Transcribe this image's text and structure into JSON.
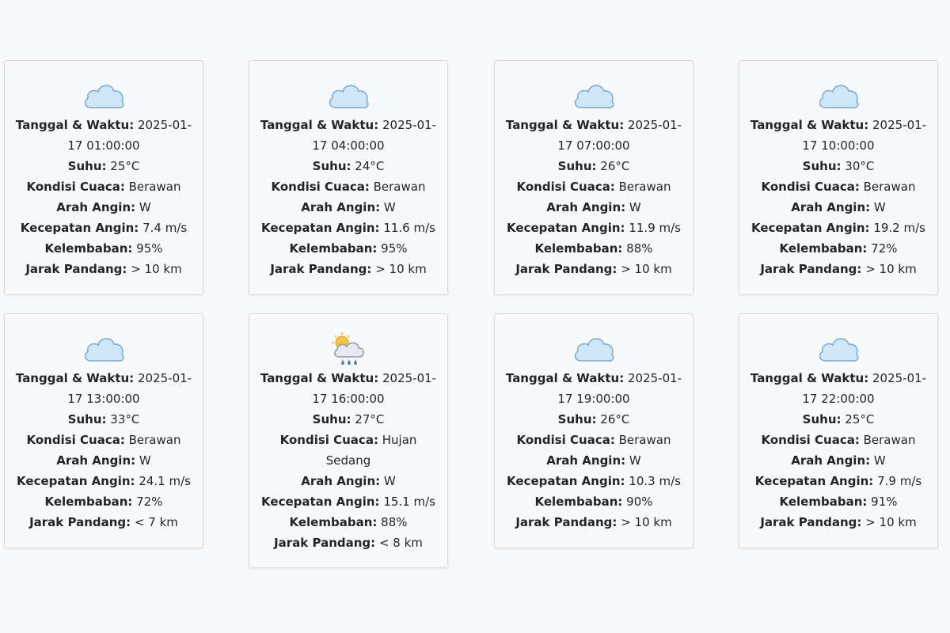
{
  "labels": {
    "datetime": "Tanggal & Waktu:",
    "temp": "Suhu:",
    "condition": "Kondisi Cuaca:",
    "wind_dir": "Arah Angin:",
    "wind_speed": "Kecepatan Angin:",
    "humidity": "Kelembaban:",
    "visibility": "Jarak Pandang:"
  },
  "forecasts": [
    {
      "icon": "cloudy-icon",
      "datetime": "2025-01-17 01:00:00",
      "temp": "25°C",
      "condition": "Berawan",
      "wind_dir": "W",
      "wind_speed": "7.4 m/s",
      "humidity": "95%",
      "visibility": "> 10 km"
    },
    {
      "icon": "cloudy-icon",
      "datetime": "2025-01-17 04:00:00",
      "temp": "24°C",
      "condition": "Berawan",
      "wind_dir": "W",
      "wind_speed": "11.6 m/s",
      "humidity": "95%",
      "visibility": "> 10 km"
    },
    {
      "icon": "cloudy-icon",
      "datetime": "2025-01-17 07:00:00",
      "temp": "26°C",
      "condition": "Berawan",
      "wind_dir": "W",
      "wind_speed": "11.9 m/s",
      "humidity": "88%",
      "visibility": "> 10 km"
    },
    {
      "icon": "cloudy-icon",
      "datetime": "2025-01-17 10:00:00",
      "temp": "30°C",
      "condition": "Berawan",
      "wind_dir": "W",
      "wind_speed": "19.2 m/s",
      "humidity": "72%",
      "visibility": "> 10 km"
    },
    {
      "icon": "cloudy-icon",
      "datetime": "2025-01-17 13:00:00",
      "temp": "33°C",
      "condition": "Berawan",
      "wind_dir": "W",
      "wind_speed": "24.1 m/s",
      "humidity": "72%",
      "visibility": "< 7 km"
    },
    {
      "icon": "rain-sun-icon",
      "datetime": "2025-01-17 16:00:00",
      "temp": "27°C",
      "condition": "Hujan Sedang",
      "wind_dir": "W",
      "wind_speed": "15.1 m/s",
      "humidity": "88%",
      "visibility": "< 8 km"
    },
    {
      "icon": "cloudy-icon",
      "datetime": "2025-01-17 19:00:00",
      "temp": "26°C",
      "condition": "Berawan",
      "wind_dir": "W",
      "wind_speed": "10.3 m/s",
      "humidity": "90%",
      "visibility": "> 10 km"
    },
    {
      "icon": "cloudy-icon",
      "datetime": "2025-01-17 22:00:00",
      "temp": "25°C",
      "condition": "Berawan",
      "wind_dir": "W",
      "wind_speed": "7.9 m/s",
      "humidity": "91%",
      "visibility": "> 10 km"
    }
  ],
  "colors": {
    "cloud_fill": "#cfe6f8",
    "cloud_stroke": "#7aa9cf",
    "sun": "#f5c542",
    "rain_cloud": "#e6e9ed",
    "rain_drop": "#5b7fa6"
  }
}
